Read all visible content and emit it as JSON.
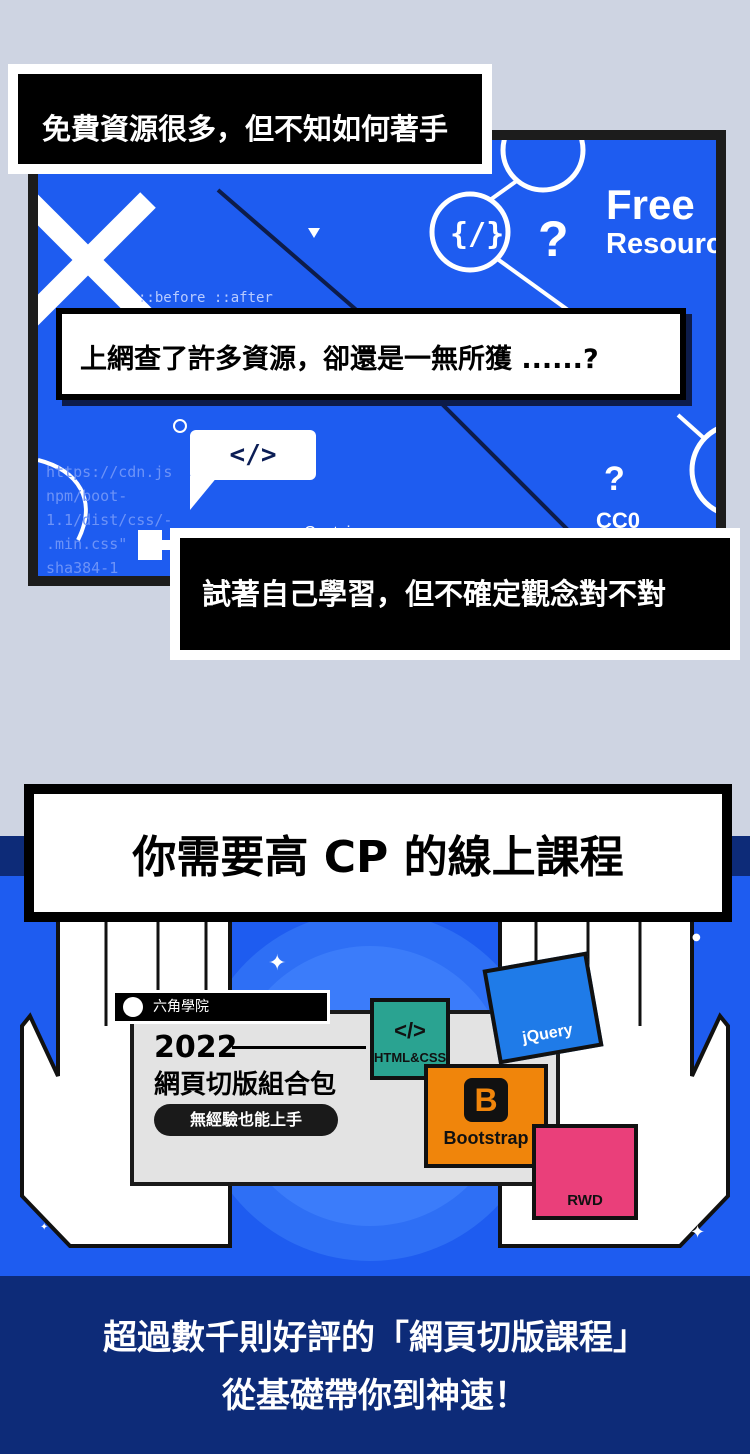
{
  "top_panel": {
    "code_bubble": "</>",
    "free_label": "Free",
    "resource_label": "Resourc",
    "pseudo_label": "::before ::after",
    "cc0_label": "CC0",
    "containers_label": "Containers",
    "cdn_lines": "https://cdn.js\nnpm/boot-\n1.1/dist/css/-\n.min.css\"\nsha384-1\n"
  },
  "callouts": {
    "c1": "免費資源很多，但不知如何著手",
    "c2": "上網查了許多資源，卻還是一無所獲 ......?",
    "c3": "試著自己學習，但不確定觀念對不對"
  },
  "course": {
    "title": "你需要高 CP 的線上課程",
    "brand": "六角學院",
    "year": "2022",
    "package": "網頁切版組合包",
    "pill": "無經驗也能上手",
    "html_css": "HTML&CSS",
    "html_css_symbol": "</>",
    "jquery": "jQuery",
    "bootstrap": "Bootstrap",
    "bootstrap_symbol": "B",
    "rwd": "RWD"
  },
  "bottom": {
    "line1": "超過數千則好評的「網頁切版課程」",
    "line2": "從基礎帶你到神速！"
  },
  "colors": {
    "page_bg": "#ced4e2",
    "panel_blue": "#1e5cf0",
    "navy": "#0d2b78",
    "html_green": "#2aa391",
    "jquery_blue": "#1f7be8",
    "bootstrap_orange": "#f0850b",
    "rwd_pink": "#ea3f7a"
  }
}
